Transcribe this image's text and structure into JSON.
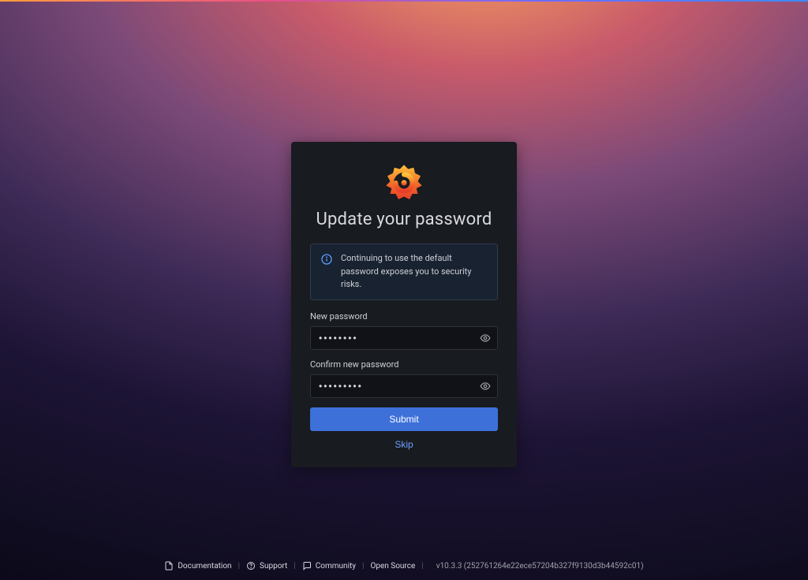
{
  "title": "Update your password",
  "alert": {
    "text": "Continuing to use the default password exposes you to security risks."
  },
  "fields": {
    "new_password": {
      "label": "New password",
      "value": "••••••••"
    },
    "confirm_password": {
      "label": "Confirm new password",
      "value": "•••••••••"
    }
  },
  "buttons": {
    "submit": "Submit",
    "skip": "Skip"
  },
  "footer": {
    "documentation": "Documentation",
    "support": "Support",
    "community": "Community",
    "open_source": "Open Source",
    "version": "v10.3.3 (252761264e22ece57204b327f9130d3b44592c01)"
  }
}
